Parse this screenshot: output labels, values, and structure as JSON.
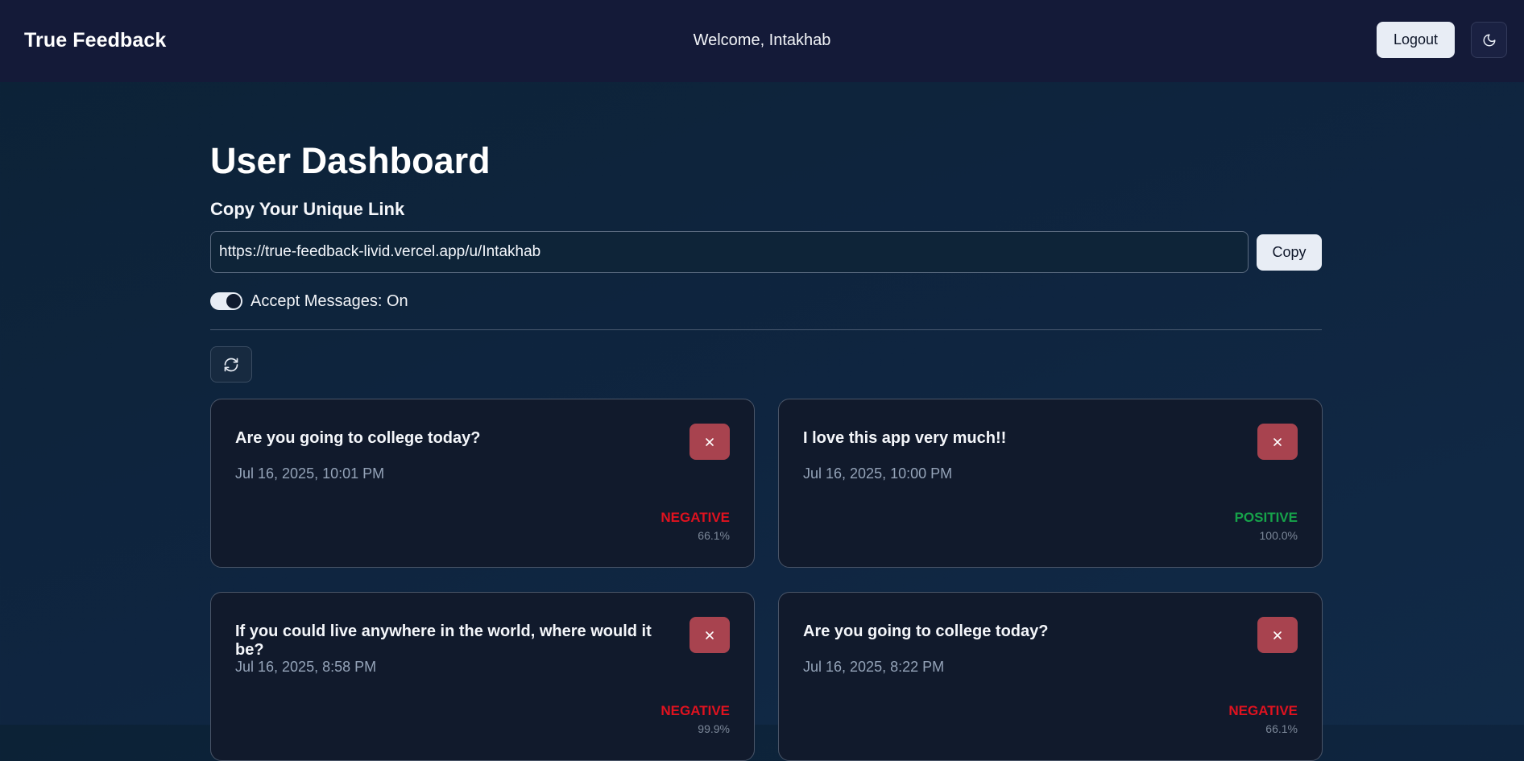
{
  "header": {
    "brand": "True Feedback",
    "welcome": "Welcome, Intakhab",
    "logout_label": "Logout",
    "theme_icon": "moon-icon"
  },
  "main": {
    "title": "User Dashboard",
    "link_section_label": "Copy Your Unique Link",
    "link_value": "https://true-feedback-livid.vercel.app/u/Intakhab",
    "copy_label": "Copy",
    "accept_messages_label": "Accept Messages: On",
    "accept_messages_on": true,
    "refresh_icon": "refresh-icon"
  },
  "colors": {
    "negative": "#e0121f",
    "positive": "#16a34a",
    "delete_button": "#a8434f"
  },
  "messages": [
    {
      "text": "Are you going to college today?",
      "date": "Jul 16, 2025, 10:01 PM",
      "sentiment": "NEGATIVE",
      "score": "66.1%"
    },
    {
      "text": "I love this app very much!!",
      "date": "Jul 16, 2025, 10:00 PM",
      "sentiment": "POSITIVE",
      "score": "100.0%"
    },
    {
      "text": "If you could live anywhere in the world, where would it be?",
      "date": "Jul 16, 2025, 8:58 PM",
      "sentiment": "NEGATIVE",
      "score": "99.9%"
    },
    {
      "text": "Are you going to college today?",
      "date": "Jul 16, 2025, 8:22 PM",
      "sentiment": "NEGATIVE",
      "score": "66.1%"
    }
  ]
}
